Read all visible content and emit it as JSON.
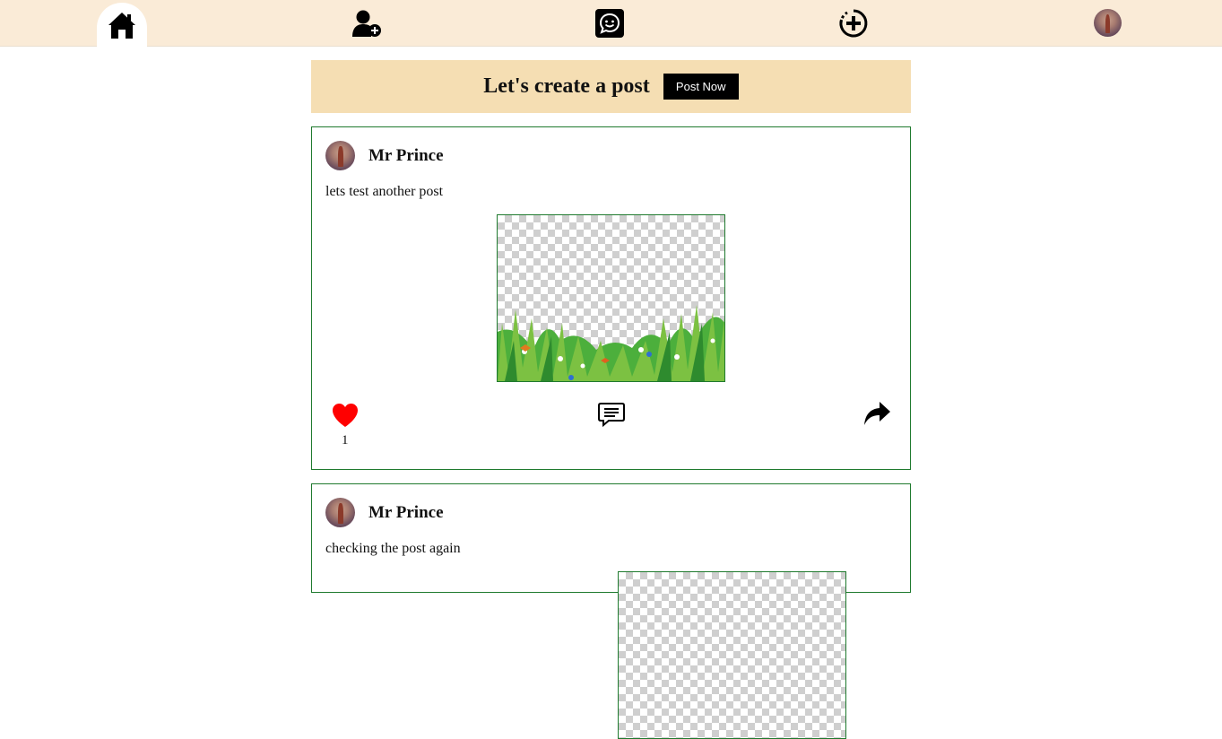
{
  "nav": {
    "items": [
      {
        "name": "home",
        "icon": "home-icon",
        "active": true
      },
      {
        "name": "add-friend",
        "icon": "user-plus-icon",
        "active": false
      },
      {
        "name": "messages",
        "icon": "chat-smile-icon",
        "active": false
      },
      {
        "name": "create",
        "icon": "plus-circle-icon",
        "active": false
      },
      {
        "name": "profile",
        "icon": "avatar",
        "active": false
      }
    ]
  },
  "banner": {
    "title": "Let's create a post",
    "button_label": "Post Now"
  },
  "posts": [
    {
      "author": "Mr Prince",
      "text": "lets test another post",
      "likes": "1",
      "liked": true
    },
    {
      "author": "Mr Prince",
      "text": "checking the post again"
    }
  ],
  "colors": {
    "nav_bg": "#faebd7",
    "banner_bg": "#f5deb3",
    "post_border": "#1f7a2e",
    "like_red": "#ff0000"
  }
}
